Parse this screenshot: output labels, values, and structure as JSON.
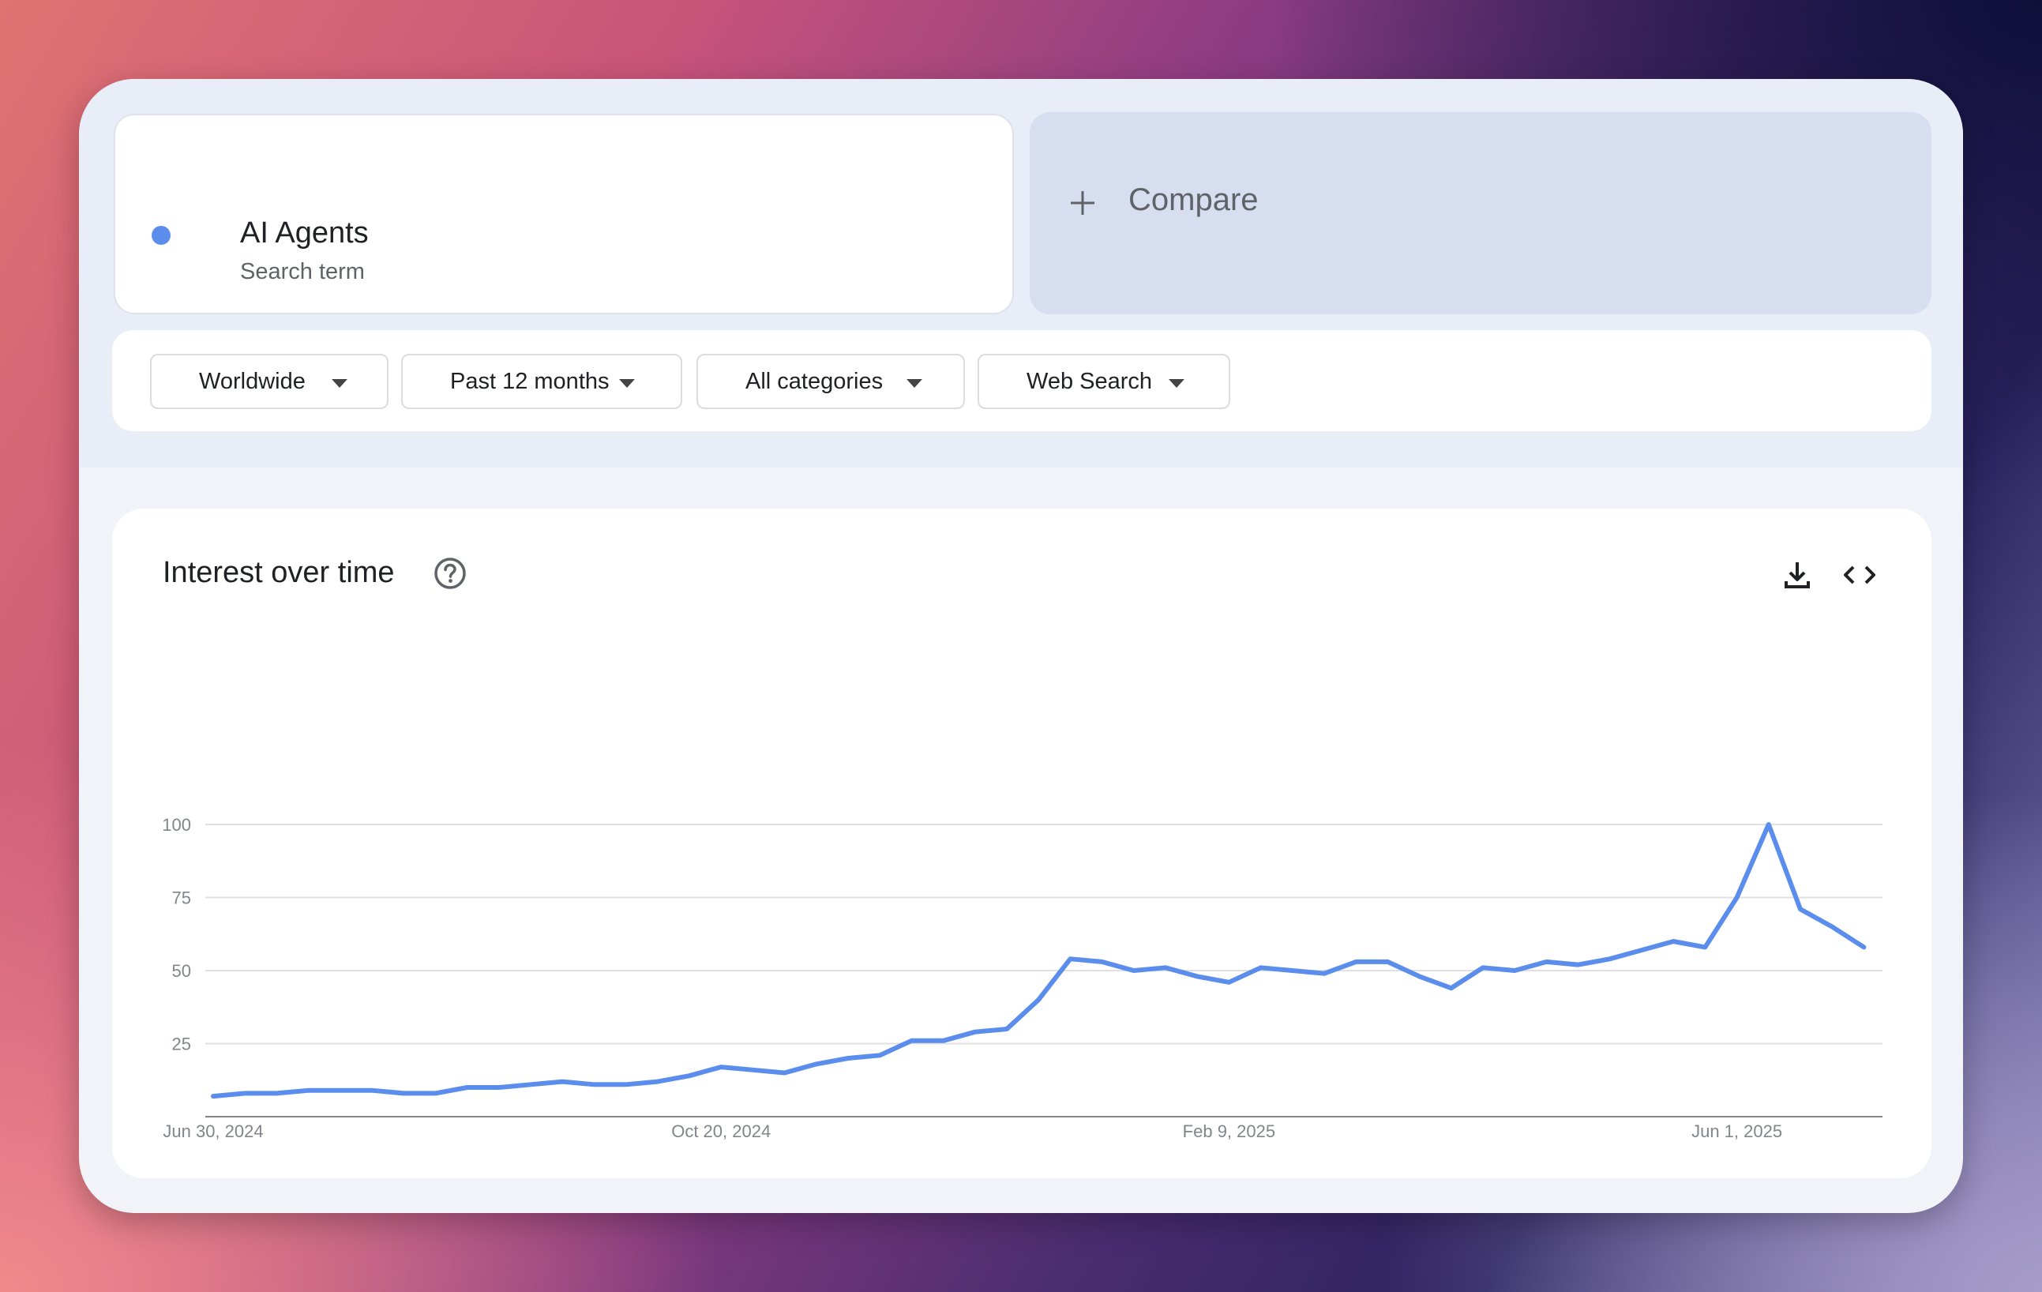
{
  "search_term": {
    "name": "AI Agents",
    "subtitle": "Search term",
    "color": "#5b8ded"
  },
  "compare": {
    "label": "Compare"
  },
  "filters": {
    "region": "Worldwide",
    "time_range": "Past 12 months",
    "category": "All categories",
    "search_type": "Web Search"
  },
  "chart_panel": {
    "title": "Interest over time"
  },
  "chart_data": {
    "type": "line",
    "title": "Interest over time",
    "xlabel": "",
    "ylabel": "",
    "ylim": [
      0,
      100
    ],
    "yticks": [
      25,
      50,
      75,
      100
    ],
    "x_tick_labels": [
      "Jun 30, 2024",
      "Oct 20, 2024",
      "Feb 9, 2025",
      "Jun 1, 2025"
    ],
    "x": [
      "2024-06-30",
      "2024-07-07",
      "2024-07-14",
      "2024-07-21",
      "2024-07-28",
      "2024-08-04",
      "2024-08-11",
      "2024-08-18",
      "2024-08-25",
      "2024-09-01",
      "2024-09-08",
      "2024-09-15",
      "2024-09-22",
      "2024-09-29",
      "2024-10-06",
      "2024-10-13",
      "2024-10-20",
      "2024-10-27",
      "2024-11-03",
      "2024-11-10",
      "2024-11-17",
      "2024-11-24",
      "2024-12-01",
      "2024-12-08",
      "2024-12-15",
      "2024-12-22",
      "2024-12-29",
      "2025-01-05",
      "2025-01-12",
      "2025-01-19",
      "2025-01-26",
      "2025-02-02",
      "2025-02-09",
      "2025-02-16",
      "2025-02-23",
      "2025-03-02",
      "2025-03-09",
      "2025-03-16",
      "2025-03-23",
      "2025-03-30",
      "2025-04-06",
      "2025-04-13",
      "2025-04-20",
      "2025-04-27",
      "2025-05-04",
      "2025-05-11",
      "2025-05-18",
      "2025-05-25",
      "2025-06-01",
      "2025-06-08",
      "2025-06-15",
      "2025-06-22"
    ],
    "grid": true,
    "series": [
      {
        "name": "AI Agents",
        "color": "#5b8ded",
        "values": [
          7,
          8,
          8,
          9,
          9,
          9,
          8,
          8,
          10,
          10,
          11,
          12,
          11,
          11,
          12,
          14,
          17,
          16,
          15,
          18,
          20,
          21,
          26,
          26,
          29,
          30,
          40,
          54,
          53,
          50,
          51,
          48,
          46,
          51,
          50,
          49,
          53,
          53,
          48,
          44,
          51,
          50,
          53,
          52,
          54,
          57,
          60,
          58,
          75,
          100,
          71,
          65,
          58
        ]
      }
    ]
  }
}
